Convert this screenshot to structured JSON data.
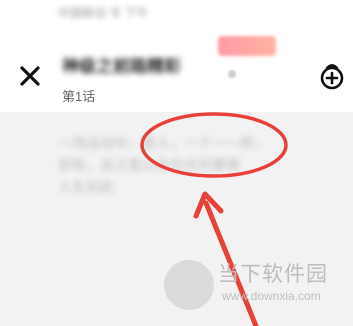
{
  "status_bar": {
    "text": "中国移动 令 下午"
  },
  "toolbar": {
    "close_icon": "close-icon",
    "title": "神级之前路精彩",
    "episode": "第1话",
    "tip_icon": "tip-add-icon"
  },
  "content": {
    "lines": [
      "一场运动中，某人，一个一一样，",
      "却有，总之是以在在任何事情",
      "人生如此"
    ]
  },
  "annotation": {
    "color": "#e8403a"
  },
  "watermark": {
    "title": "当下软件园",
    "url": "www.downxia.com"
  }
}
